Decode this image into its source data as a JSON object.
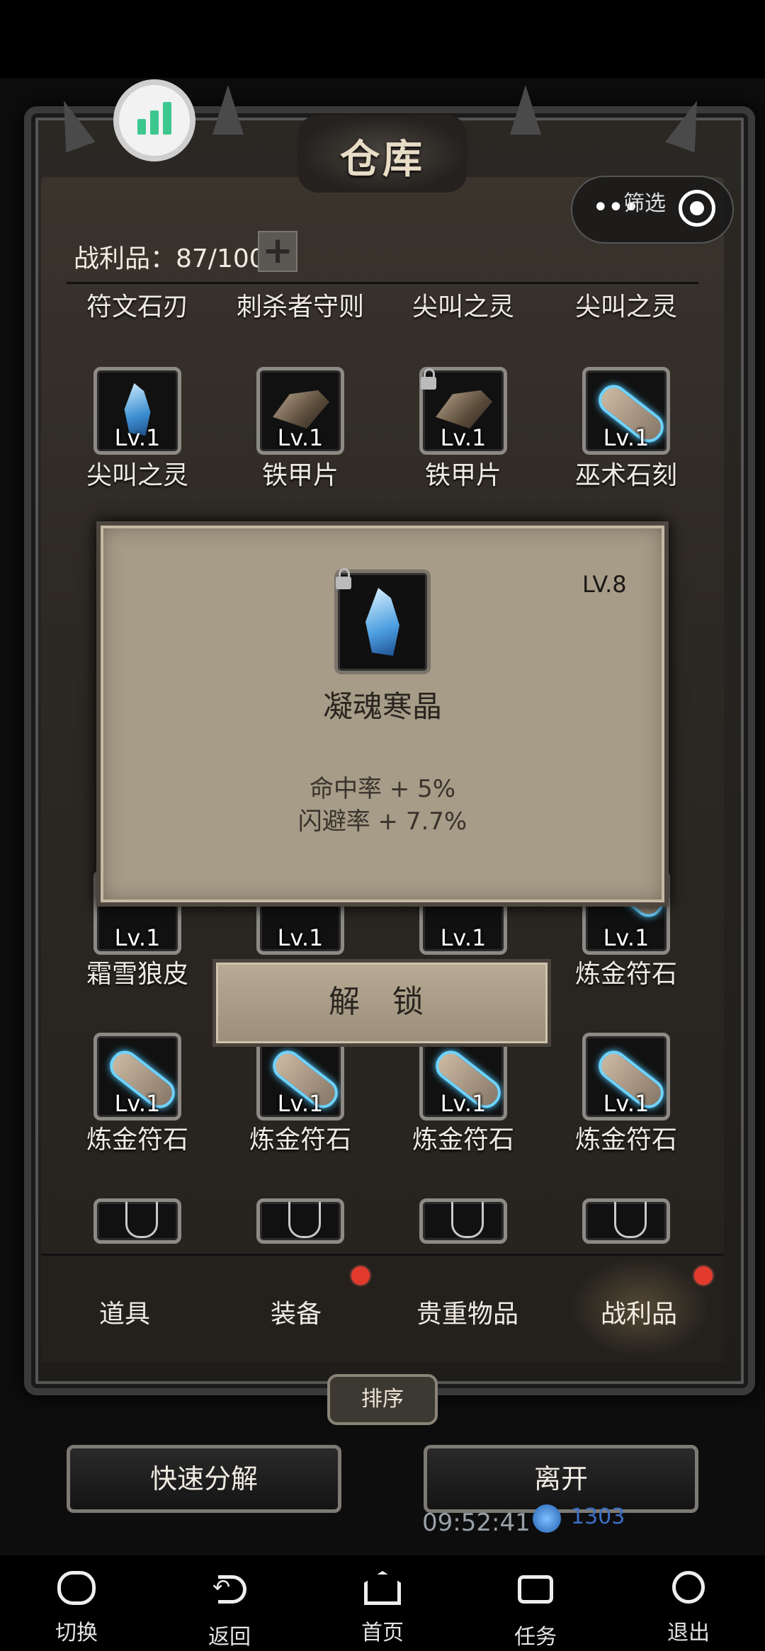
{
  "header": {
    "title": "仓库"
  },
  "filter": {
    "label": "筛选",
    "dots": "•••"
  },
  "inventory": {
    "capacity": "战利品：87/100",
    "add": "+"
  },
  "row0_names": [
    "符文石刃",
    "刺杀者守则",
    "尖叫之灵",
    "尖叫之灵"
  ],
  "row1": [
    {
      "lv": "Lv.1",
      "name": "尖叫之灵",
      "icon": "shard-icon",
      "locked": false
    },
    {
      "lv": "Lv.1",
      "name": "铁甲片",
      "icon": "plate-icon",
      "locked": false
    },
    {
      "lv": "Lv.1",
      "name": "铁甲片",
      "icon": "plate-icon",
      "locked": true
    },
    {
      "lv": "Lv.1",
      "name": "巫术石刻",
      "icon": "stone-icon",
      "locked": false
    }
  ],
  "row2": [
    {
      "lv": "Lv.1",
      "name": "霜雪狼皮"
    },
    {
      "lv": "Lv.1",
      "name": ""
    },
    {
      "lv": "Lv.1",
      "name": ""
    },
    {
      "lv": "Lv.1",
      "name": "炼金符石"
    }
  ],
  "row3": [
    {
      "lv": "Lv.1",
      "name": "炼金符石"
    },
    {
      "lv": "Lv.1",
      "name": "炼金符石"
    },
    {
      "lv": "Lv.1",
      "name": "炼金符石"
    },
    {
      "lv": "Lv.1",
      "name": "炼金符石"
    }
  ],
  "popup": {
    "level": "LV.8",
    "name": "凝魂寒晶",
    "stat1": "命中率 + 5%",
    "stat2": "闪避率 + 7.7%",
    "unlock": "解 锁"
  },
  "tabs": [
    {
      "label": "道具",
      "badge": false
    },
    {
      "label": "装备",
      "badge": true
    },
    {
      "label": "贵重物品",
      "badge": false
    },
    {
      "label": "战利品",
      "badge": true,
      "active": true
    }
  ],
  "buttons": {
    "sort": "排序",
    "decompose": "快速分解",
    "leave": "离开"
  },
  "status": {
    "time": "09:52:41",
    "gems": "1303"
  },
  "nav": [
    "切换",
    "返回",
    "首页",
    "任务",
    "退出"
  ],
  "colors": {
    "badge": "#e23a2c",
    "bubble_bars": "#3cc78f",
    "popup_bg": "#a79c88"
  }
}
